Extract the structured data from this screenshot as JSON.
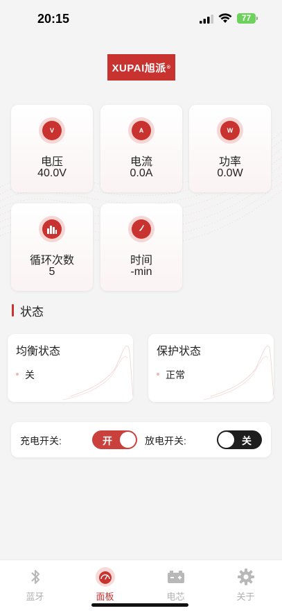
{
  "status_bar": {
    "time": "20:15",
    "battery": "77"
  },
  "logo": {
    "text": "XUPAI旭派",
    "reg": "®"
  },
  "cards": [
    {
      "icon": "voltmeter-icon",
      "icon_letter": "V",
      "label": "电压",
      "value": "40.0V"
    },
    {
      "icon": "ammeter-icon",
      "icon_letter": "A",
      "label": "电流",
      "value": "0.0A"
    },
    {
      "icon": "wattmeter-icon",
      "icon_letter": "W",
      "label": "功率",
      "value": "0.0W"
    },
    {
      "icon": "bar-chart-icon",
      "label": "循环次数",
      "value": "5"
    },
    {
      "icon": "clock-icon",
      "label": "时间",
      "value": "-min"
    }
  ],
  "section": {
    "title": "状态"
  },
  "status_cards": [
    {
      "title": "均衡状态",
      "value": "关"
    },
    {
      "title": "保护状态",
      "value": "正常"
    }
  ],
  "switches": {
    "charge_label": "充电开关:",
    "charge_state": "开",
    "discharge_label": "放电开关:",
    "discharge_state": "关"
  },
  "tabs": [
    {
      "label": "蓝牙",
      "icon": "bluetooth-icon",
      "active": false
    },
    {
      "label": "面板",
      "icon": "dashboard-icon",
      "active": true
    },
    {
      "label": "电芯",
      "icon": "battery-cell-icon",
      "active": false
    },
    {
      "label": "关于",
      "icon": "gear-icon",
      "active": false
    }
  ],
  "colors": {
    "accent": "#c8322f",
    "toggle_on": "#c9403c",
    "toggle_off": "#1e1e1e"
  }
}
